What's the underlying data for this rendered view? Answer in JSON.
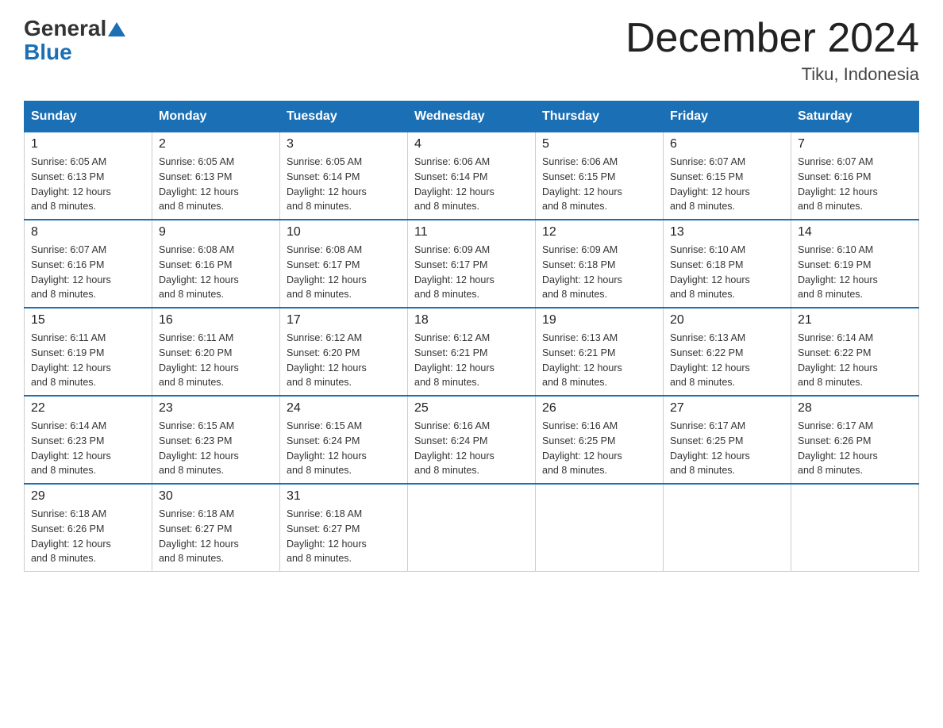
{
  "header": {
    "logo_general": "General",
    "logo_blue": "Blue",
    "month_title": "December 2024",
    "location": "Tiku, Indonesia"
  },
  "days_of_week": [
    "Sunday",
    "Monday",
    "Tuesday",
    "Wednesday",
    "Thursday",
    "Friday",
    "Saturday"
  ],
  "weeks": [
    [
      {
        "day": "1",
        "sunrise": "6:05 AM",
        "sunset": "6:13 PM",
        "daylight": "12 hours and 8 minutes."
      },
      {
        "day": "2",
        "sunrise": "6:05 AM",
        "sunset": "6:13 PM",
        "daylight": "12 hours and 8 minutes."
      },
      {
        "day": "3",
        "sunrise": "6:05 AM",
        "sunset": "6:14 PM",
        "daylight": "12 hours and 8 minutes."
      },
      {
        "day": "4",
        "sunrise": "6:06 AM",
        "sunset": "6:14 PM",
        "daylight": "12 hours and 8 minutes."
      },
      {
        "day": "5",
        "sunrise": "6:06 AM",
        "sunset": "6:15 PM",
        "daylight": "12 hours and 8 minutes."
      },
      {
        "day": "6",
        "sunrise": "6:07 AM",
        "sunset": "6:15 PM",
        "daylight": "12 hours and 8 minutes."
      },
      {
        "day": "7",
        "sunrise": "6:07 AM",
        "sunset": "6:16 PM",
        "daylight": "12 hours and 8 minutes."
      }
    ],
    [
      {
        "day": "8",
        "sunrise": "6:07 AM",
        "sunset": "6:16 PM",
        "daylight": "12 hours and 8 minutes."
      },
      {
        "day": "9",
        "sunrise": "6:08 AM",
        "sunset": "6:16 PM",
        "daylight": "12 hours and 8 minutes."
      },
      {
        "day": "10",
        "sunrise": "6:08 AM",
        "sunset": "6:17 PM",
        "daylight": "12 hours and 8 minutes."
      },
      {
        "day": "11",
        "sunrise": "6:09 AM",
        "sunset": "6:17 PM",
        "daylight": "12 hours and 8 minutes."
      },
      {
        "day": "12",
        "sunrise": "6:09 AM",
        "sunset": "6:18 PM",
        "daylight": "12 hours and 8 minutes."
      },
      {
        "day": "13",
        "sunrise": "6:10 AM",
        "sunset": "6:18 PM",
        "daylight": "12 hours and 8 minutes."
      },
      {
        "day": "14",
        "sunrise": "6:10 AM",
        "sunset": "6:19 PM",
        "daylight": "12 hours and 8 minutes."
      }
    ],
    [
      {
        "day": "15",
        "sunrise": "6:11 AM",
        "sunset": "6:19 PM",
        "daylight": "12 hours and 8 minutes."
      },
      {
        "day": "16",
        "sunrise": "6:11 AM",
        "sunset": "6:20 PM",
        "daylight": "12 hours and 8 minutes."
      },
      {
        "day": "17",
        "sunrise": "6:12 AM",
        "sunset": "6:20 PM",
        "daylight": "12 hours and 8 minutes."
      },
      {
        "day": "18",
        "sunrise": "6:12 AM",
        "sunset": "6:21 PM",
        "daylight": "12 hours and 8 minutes."
      },
      {
        "day": "19",
        "sunrise": "6:13 AM",
        "sunset": "6:21 PM",
        "daylight": "12 hours and 8 minutes."
      },
      {
        "day": "20",
        "sunrise": "6:13 AM",
        "sunset": "6:22 PM",
        "daylight": "12 hours and 8 minutes."
      },
      {
        "day": "21",
        "sunrise": "6:14 AM",
        "sunset": "6:22 PM",
        "daylight": "12 hours and 8 minutes."
      }
    ],
    [
      {
        "day": "22",
        "sunrise": "6:14 AM",
        "sunset": "6:23 PM",
        "daylight": "12 hours and 8 minutes."
      },
      {
        "day": "23",
        "sunrise": "6:15 AM",
        "sunset": "6:23 PM",
        "daylight": "12 hours and 8 minutes."
      },
      {
        "day": "24",
        "sunrise": "6:15 AM",
        "sunset": "6:24 PM",
        "daylight": "12 hours and 8 minutes."
      },
      {
        "day": "25",
        "sunrise": "6:16 AM",
        "sunset": "6:24 PM",
        "daylight": "12 hours and 8 minutes."
      },
      {
        "day": "26",
        "sunrise": "6:16 AM",
        "sunset": "6:25 PM",
        "daylight": "12 hours and 8 minutes."
      },
      {
        "day": "27",
        "sunrise": "6:17 AM",
        "sunset": "6:25 PM",
        "daylight": "12 hours and 8 minutes."
      },
      {
        "day": "28",
        "sunrise": "6:17 AM",
        "sunset": "6:26 PM",
        "daylight": "12 hours and 8 minutes."
      }
    ],
    [
      {
        "day": "29",
        "sunrise": "6:18 AM",
        "sunset": "6:26 PM",
        "daylight": "12 hours and 8 minutes."
      },
      {
        "day": "30",
        "sunrise": "6:18 AM",
        "sunset": "6:27 PM",
        "daylight": "12 hours and 8 minutes."
      },
      {
        "day": "31",
        "sunrise": "6:18 AM",
        "sunset": "6:27 PM",
        "daylight": "12 hours and 8 minutes."
      },
      null,
      null,
      null,
      null
    ]
  ]
}
